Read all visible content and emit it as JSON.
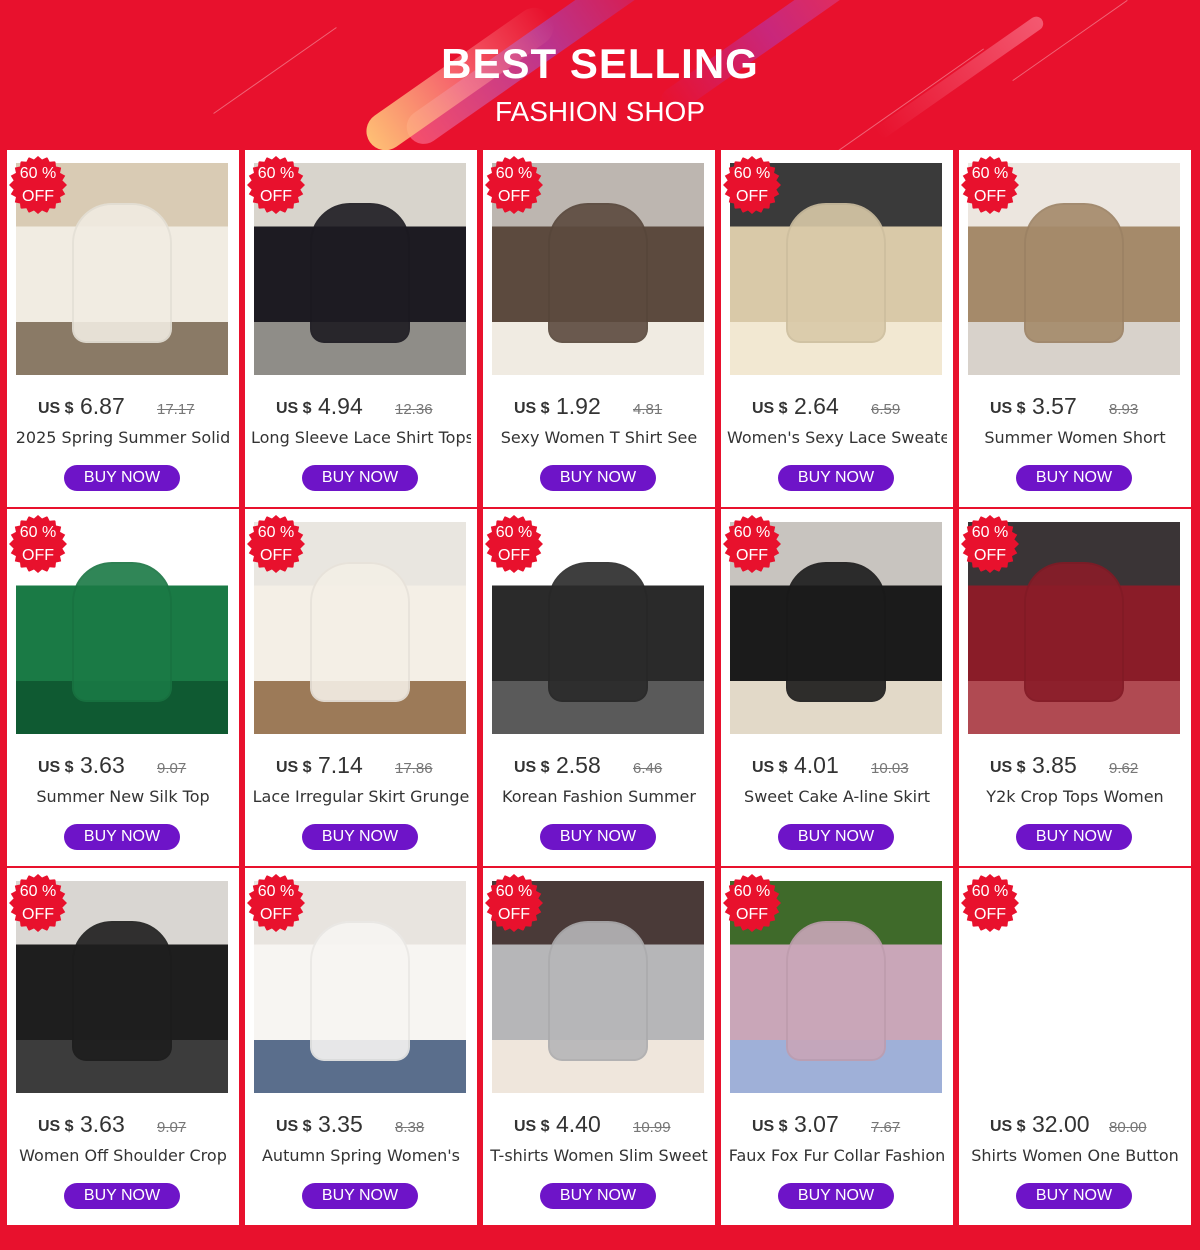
{
  "header": {
    "title": "BEST SELLING",
    "subtitle": "FASHION SHOP"
  },
  "colors": {
    "background": "#e8112d",
    "button": "#6e14c8",
    "badge": "#e8112d"
  },
  "products": [
    {
      "badge_top": "60 %",
      "badge_bottom": "OFF",
      "currency": "US $",
      "price": "6.87",
      "old_price": "17.17",
      "title": "2025 Spring Summer Solid",
      "button": "BUY NOW",
      "image": "cream-lace-cardigan-photo",
      "palette": [
        "#d9cbb4",
        "#f1ece2",
        "#8a7a66"
      ]
    },
    {
      "badge_top": "60 %",
      "badge_bottom": "OFF",
      "currency": "US $",
      "price": "4.94",
      "old_price": "12.36",
      "title": "Long Sleeve Lace Shirt Tops",
      "button": "BUY NOW",
      "image": "black-lace-shirt-photo",
      "palette": [
        "#d8d4cc",
        "#1d1b22",
        "#8f8d88"
      ]
    },
    {
      "badge_top": "60 %",
      "badge_bottom": "OFF",
      "currency": "US $",
      "price": "1.92",
      "old_price": "4.81",
      "title": "Sexy Women T Shirt See",
      "button": "BUY NOW",
      "image": "mesh-tops-colors-photo",
      "palette": [
        "#bdb6b0",
        "#5c4a3e",
        "#f0ebe2"
      ]
    },
    {
      "badge_top": "60 %",
      "badge_bottom": "OFF",
      "currency": "US $",
      "price": "2.64",
      "old_price": "6.59",
      "title": "Women's Sexy Lace Sweater",
      "button": "BUY NOW",
      "image": "beige-lace-sweater-photo",
      "palette": [
        "#3a3a3a",
        "#d9c9a8",
        "#f2e8d2"
      ]
    },
    {
      "badge_top": "60 %",
      "badge_bottom": "OFF",
      "currency": "US $",
      "price": "3.57",
      "old_price": "8.93",
      "title": "Summer Women Short",
      "button": "BUY NOW",
      "image": "satin-tee-photo",
      "palette": [
        "#ece6df",
        "#a58a6a",
        "#d8d2cb"
      ]
    },
    {
      "badge_top": "60 %",
      "badge_bottom": "OFF",
      "currency": "US $",
      "price": "3.63",
      "old_price": "9.07",
      "title": "Summer New Silk Top",
      "button": "BUY NOW",
      "image": "green-silk-cami-photo",
      "palette": [
        "#ffffff",
        "#1a7a45",
        "#0f5a32"
      ]
    },
    {
      "badge_top": "60 %",
      "badge_bottom": "OFF",
      "currency": "US $",
      "price": "7.14",
      "old_price": "17.86",
      "title": "Lace Irregular Skirt Grunge",
      "button": "BUY NOW",
      "image": "white-lace-skirt-photo",
      "palette": [
        "#e9e6e0",
        "#f4efe6",
        "#9c7a58"
      ]
    },
    {
      "badge_top": "60 %",
      "badge_bottom": "OFF",
      "currency": "US $",
      "price": "2.58",
      "old_price": "6.46",
      "title": "Korean Fashion Summer",
      "button": "BUY NOW",
      "image": "black-lace-skirt-photo",
      "palette": [
        "#ffffff",
        "#2a2a2a",
        "#5a5a5a"
      ]
    },
    {
      "badge_top": "60 %",
      "badge_bottom": "OFF",
      "currency": "US $",
      "price": "4.01",
      "old_price": "10.03",
      "title": "Sweet Cake A-line Skirt",
      "button": "BUY NOW",
      "image": "black-tiered-skirt-photo",
      "palette": [
        "#c8c4bf",
        "#1b1b1b",
        "#e2d9c8"
      ]
    },
    {
      "badge_top": "60 %",
      "badge_bottom": "OFF",
      "currency": "US $",
      "price": "3.85",
      "old_price": "9.62",
      "title": "Y2k Crop Tops Women",
      "button": "BUY NOW",
      "image": "red-mesh-crop-top-photo",
      "palette": [
        "#3a3436",
        "#8a1c28",
        "#b04a52"
      ]
    },
    {
      "badge_top": "60 %",
      "badge_bottom": "OFF",
      "currency": "US $",
      "price": "3.63",
      "old_price": "9.07",
      "title": "Women Off Shoulder Crop",
      "button": "BUY NOW",
      "image": "black-knit-top-photo",
      "palette": [
        "#d9d6d2",
        "#1e1e1e",
        "#3c3c3c"
      ]
    },
    {
      "badge_top": "60 %",
      "badge_bottom": "OFF",
      "currency": "US $",
      "price": "3.35",
      "old_price": "8.38",
      "title": "Autumn Spring Women's",
      "button": "BUY NOW",
      "image": "white-crop-cardigan-photo",
      "palette": [
        "#e8e4df",
        "#f7f5f2",
        "#5a6e8c"
      ]
    },
    {
      "badge_top": "60 %",
      "badge_bottom": "OFF",
      "currency": "US $",
      "price": "4.40",
      "old_price": "10.99",
      "title": "T-shirts Women Slim Sweet",
      "button": "BUY NOW",
      "image": "grey-ruffle-tee-photo",
      "palette": [
        "#4a3a38",
        "#b6b6b8",
        "#efe6dc"
      ]
    },
    {
      "badge_top": "60 %",
      "badge_bottom": "OFF",
      "currency": "US $",
      "price": "3.07",
      "old_price": "7.67",
      "title": "Faux Fox Fur Collar Fashion",
      "button": "BUY NOW",
      "image": "fur-collars-photo",
      "palette": [
        "#3f6a2a",
        "#c9a6b8",
        "#9fb0d8"
      ]
    },
    {
      "badge_top": "60 %",
      "badge_bottom": "OFF",
      "currency": "US $",
      "price": "32.00",
      "old_price": "80.00",
      "title": "Shirts Women One Button",
      "button": "BUY NOW",
      "image": "blank-image",
      "palette": [
        "#ffffff",
        "#ffffff",
        "#ffffff"
      ]
    }
  ]
}
